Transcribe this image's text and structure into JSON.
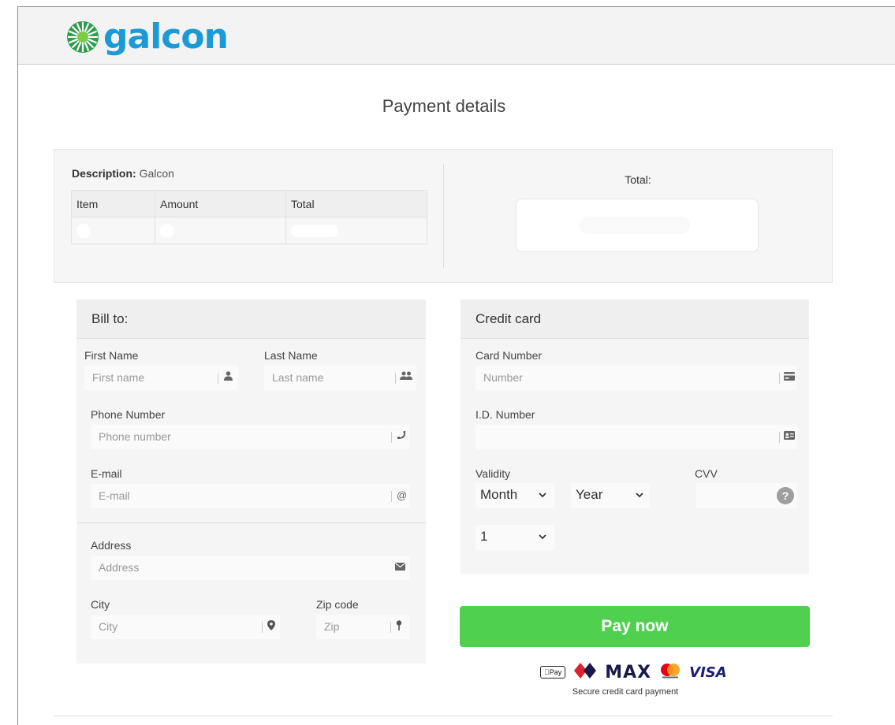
{
  "brand": {
    "name": "galcon",
    "color": "#1b9ad6"
  },
  "page_title": "Payment details",
  "summary": {
    "description_label": "Description:",
    "description_value": "Galcon",
    "columns": [
      "Item",
      "Amount",
      "Total"
    ],
    "total_label": "Total:"
  },
  "bill_to": {
    "title": "Bill to:",
    "first_name": {
      "label": "First Name",
      "placeholder": "First name",
      "icon": "user-icon"
    },
    "last_name": {
      "label": "Last Name",
      "placeholder": "Last name",
      "icon": "users-icon"
    },
    "phone": {
      "label": "Phone Number",
      "placeholder": "Phone number",
      "icon": "phone-icon"
    },
    "email": {
      "label": "E-mail",
      "placeholder": "E-mail",
      "icon": "at-icon"
    },
    "address": {
      "label": "Address",
      "placeholder": "Address",
      "icon": "envelope-icon"
    },
    "city": {
      "label": "City",
      "placeholder": "City",
      "icon": "map-marker-icon"
    },
    "zip": {
      "label": "Zip code",
      "placeholder": "Zip",
      "icon": "pin-icon"
    }
  },
  "credit_card": {
    "title": "Credit card",
    "card_number": {
      "label": "Card Number",
      "placeholder": "Number",
      "icon": "credit-card-icon"
    },
    "id_number": {
      "label": "I.D. Number",
      "placeholder": "",
      "icon": "id-card-icon"
    },
    "validity_label": "Validity",
    "month": "Month",
    "year": "Year",
    "cvv_label": "CVV",
    "cvv_help": "?",
    "installments": "1"
  },
  "pay_button": "Pay now",
  "payment_logos": [
    "Apple Pay",
    "MAX",
    "Mastercard",
    "VISA"
  ],
  "apple_pay_text": "Pay",
  "max_text": "MAX",
  "visa_text": "VISA",
  "secure_text": "Secure credit card payment",
  "colors": {
    "pay_button": "#4fd04f",
    "panel_bg": "#f5f5f5"
  }
}
